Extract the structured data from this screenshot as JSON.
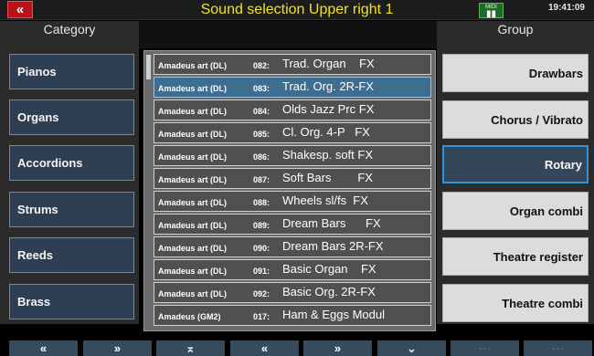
{
  "header": {
    "back_label": "«",
    "title": "Sound selection Upper right 1",
    "midi_label": "MIDI",
    "clock": "19:41:09"
  },
  "categories_heading": "Category",
  "groups_heading": "Group",
  "categories": [
    {
      "label": "Pianos"
    },
    {
      "label": "Organs"
    },
    {
      "label": "Accordions"
    },
    {
      "label": "Strums"
    },
    {
      "label": "Reeds"
    },
    {
      "label": "Brass"
    }
  ],
  "groups": [
    {
      "label": "Drawbars"
    },
    {
      "label": "Chorus  /  Vibrato"
    },
    {
      "label": "Rotary"
    },
    {
      "label": "Organ combi"
    },
    {
      "label": "Theatre register"
    },
    {
      "label": "Theatre combi"
    }
  ],
  "sounds": [
    {
      "bank": "Amadeus art (DL)",
      "number": "082:",
      "name": "Trad. Organ    FX"
    },
    {
      "bank": "Amadeus art (DL)",
      "number": "083:",
      "name": "Trad. Org. 2R-FX"
    },
    {
      "bank": "Amadeus art (DL)",
      "number": "084:",
      "name": "Olds Jazz Prc FX"
    },
    {
      "bank": "Amadeus art (DL)",
      "number": "085:",
      "name": "Cl. Org. 4-P   FX"
    },
    {
      "bank": "Amadeus art (DL)",
      "number": "086:",
      "name": "Shakesp. soft FX"
    },
    {
      "bank": "Amadeus art (DL)",
      "number": "087:",
      "name": "Soft Bars        FX"
    },
    {
      "bank": "Amadeus art (DL)",
      "number": "088:",
      "name": "Wheels sl/fs  FX"
    },
    {
      "bank": "Amadeus art (DL)",
      "number": "089:",
      "name": "Dream Bars      FX"
    },
    {
      "bank": "Amadeus art (DL)",
      "number": "090:",
      "name": "Dream Bars 2R-FX"
    },
    {
      "bank": "Amadeus art (DL)",
      "number": "091:",
      "name": "Basic Organ    FX"
    },
    {
      "bank": "Amadeus art (DL)",
      "number": "092:",
      "name": "Basic Org. 2R-FX"
    },
    {
      "bank": "Amadeus (GM2)",
      "number": "017:",
      "name": "Ham & Eggs Modul"
    }
  ],
  "toolbar": [
    {
      "label": "«",
      "icon": "double-chevron-up-icon"
    },
    {
      "label": "»",
      "icon": "double-chevron-down-icon"
    },
    {
      "label": "⌅",
      "icon": "scroll-top-icon"
    },
    {
      "label": "«",
      "icon": "chevron-up-icon"
    },
    {
      "label": "»",
      "icon": "chevron-down-icon"
    },
    {
      "label": "⌄",
      "icon": "scroll-bottom-icon"
    },
    {
      "label": "- - -",
      "icon": "empty-slot"
    },
    {
      "label": "- - -",
      "icon": "empty-slot"
    }
  ],
  "colors": {
    "title_yellow": "#f1e41d",
    "selected_blue": "#2f94e0",
    "back_red": "#b8121b"
  }
}
